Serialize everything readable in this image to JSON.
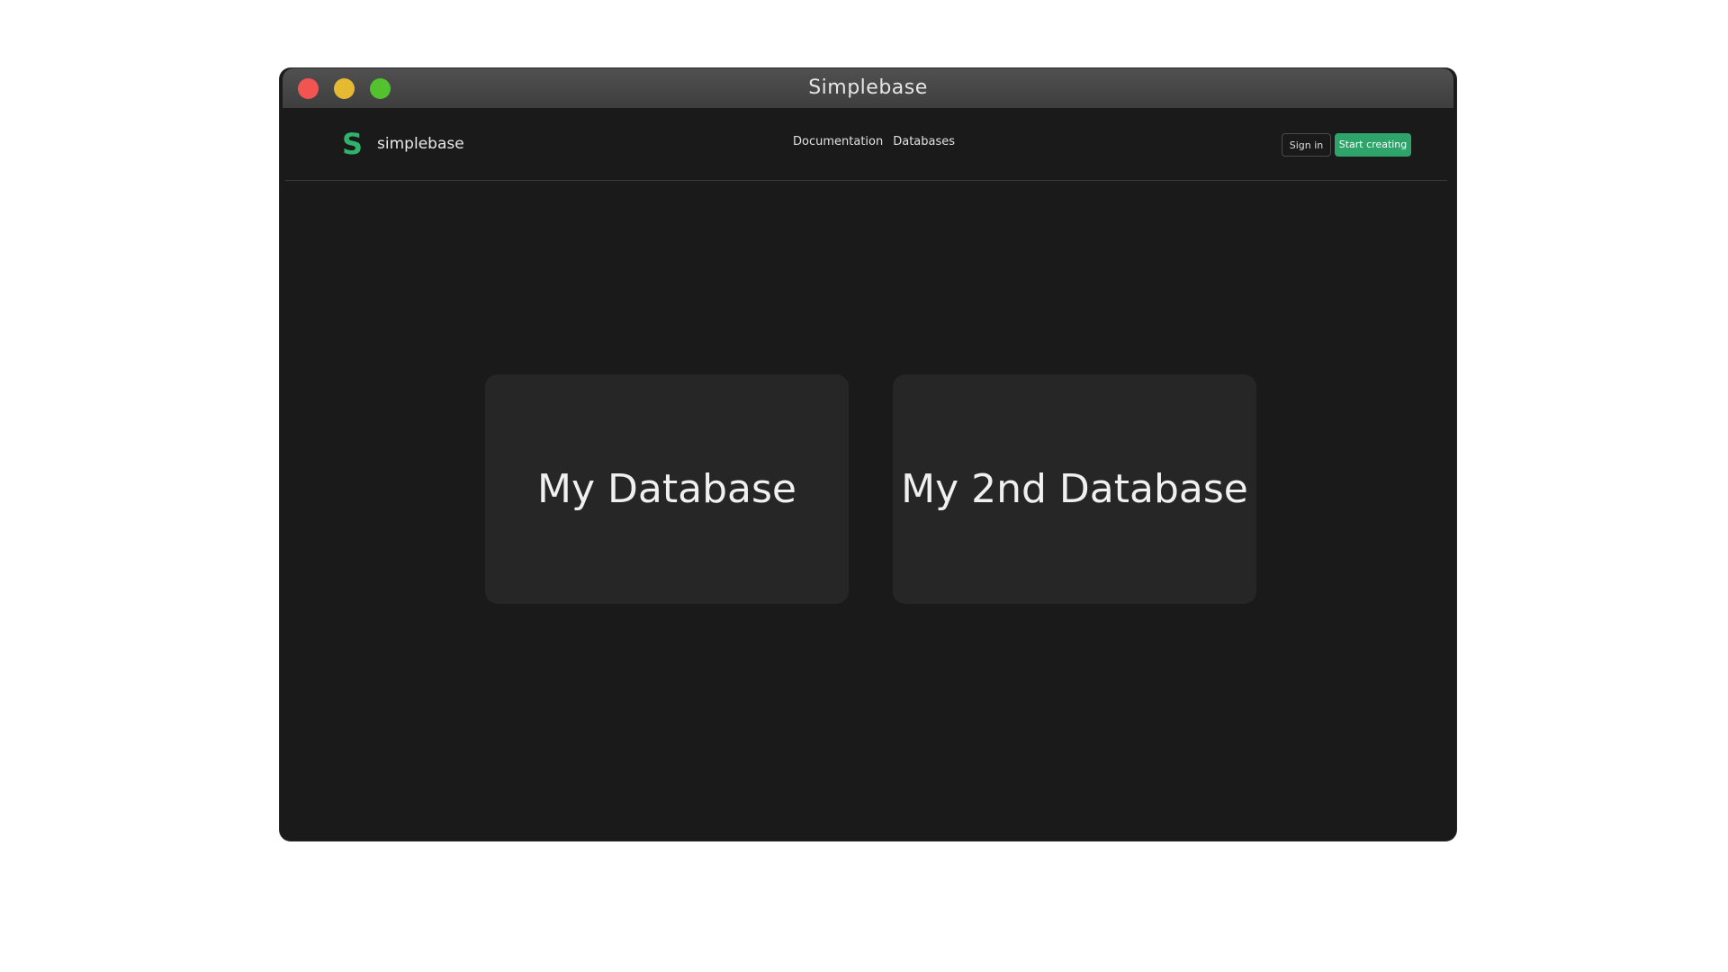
{
  "window": {
    "title": "Simplebase"
  },
  "brand": {
    "logo_glyph": "S",
    "name": "simplebase",
    "logo_color": "#2eb36b"
  },
  "nav": {
    "links": [
      "Documentation",
      "Databases"
    ]
  },
  "actions": {
    "sign_in": "Sign in",
    "start_creating": "Start creating",
    "accent_color": "#2ea36a"
  },
  "databases": [
    {
      "name": "My Database"
    },
    {
      "name": "My 2nd Database"
    }
  ],
  "colors": {
    "background": "#1a1a1a",
    "card": "#262626"
  }
}
